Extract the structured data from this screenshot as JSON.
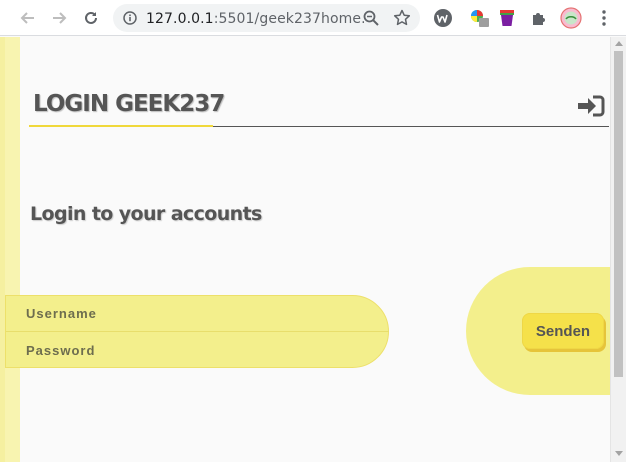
{
  "browser": {
    "url_host": "127.0.0.1",
    "url_rest": ":5501/geek237home...",
    "icons": [
      "back-arrow-icon",
      "forward-arrow-icon",
      "reload-icon",
      "info-icon",
      "zoom-icon",
      "star-icon",
      "extension-w-icon",
      "extension-color-icon",
      "extension-bucket-icon",
      "puzzle-icon",
      "avatar-icon",
      "kebab-menu-icon"
    ]
  },
  "page": {
    "brand": "LOGIN GEEK237",
    "heading": "Login to your accounts",
    "username_placeholder": "Username",
    "password_placeholder": "Password",
    "submit_label": "Senden"
  },
  "colors": {
    "accent_yellow": "#f3ef8c",
    "button_yellow": "#f5e14a",
    "text_grey": "#555555"
  }
}
